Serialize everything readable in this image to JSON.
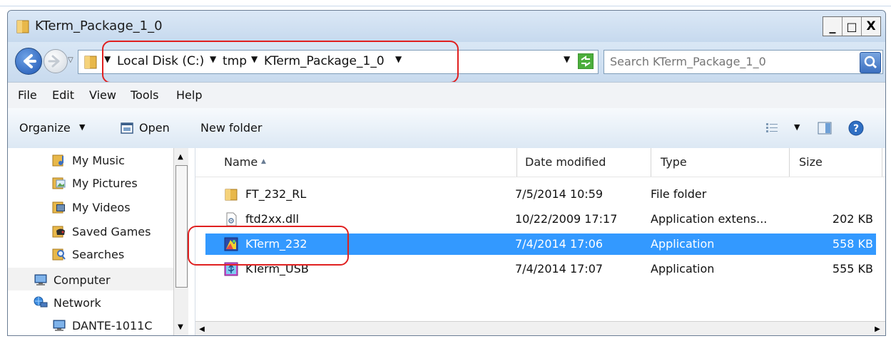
{
  "window": {
    "title": "KTerm_Package_1_0"
  },
  "window_buttons": {
    "minimize": "_",
    "maximize": "□",
    "close": "X"
  },
  "address_bar": {
    "crumbs": [
      "Local Disk (C:)",
      "tmp",
      "KTerm_Package_1_0"
    ],
    "sep": "▼"
  },
  "search": {
    "placeholder": "Search KTerm_Package_1_0"
  },
  "menu": [
    "File",
    "Edit",
    "View",
    "Tools",
    "Help"
  ],
  "toolbar": {
    "organize": "Organize",
    "organize_arrow": "▼",
    "open": "Open",
    "new_folder": "New folder",
    "views_arrow": "▼"
  },
  "nav_pane": {
    "items": [
      "My Music",
      "My Pictures",
      "My Videos",
      "Saved Games",
      "Searches",
      "Computer",
      "Network",
      "DANTE-1011C"
    ]
  },
  "columns": {
    "name": "Name",
    "sort_arrow": "▲",
    "date": "Date modified",
    "type": "Type",
    "size": "Size"
  },
  "files": [
    {
      "name": "FT_232_RL",
      "date": "7/5/2014 10:59",
      "type": "File folder",
      "size": ""
    },
    {
      "name": "ftd2xx.dll",
      "date": "10/22/2009 17:17",
      "type": "Application extens...",
      "size": "202 KB"
    },
    {
      "name": "KTerm_232",
      "date": "7/4/2014 17:06",
      "type": "Application",
      "size": "558 KB"
    },
    {
      "name": "KTerm_USB",
      "date": "7/4/2014 17:07",
      "type": "Application",
      "size": "555 KB"
    }
  ],
  "selected_file": "KTerm_232",
  "colors": {
    "selection": "#3399ff",
    "annotation": "#e02020",
    "folder": "#e8b84a"
  },
  "icons": [
    "folder-icon",
    "back-arrow-icon",
    "forward-arrow-icon",
    "refresh-icon",
    "search-icon",
    "open-icon",
    "view-options-icon",
    "preview-pane-icon",
    "help-icon",
    "music-folder-icon",
    "pictures-folder-icon",
    "videos-folder-icon",
    "saved-games-icon",
    "searches-icon",
    "computer-icon",
    "network-icon",
    "dll-icon",
    "application-icon"
  ]
}
